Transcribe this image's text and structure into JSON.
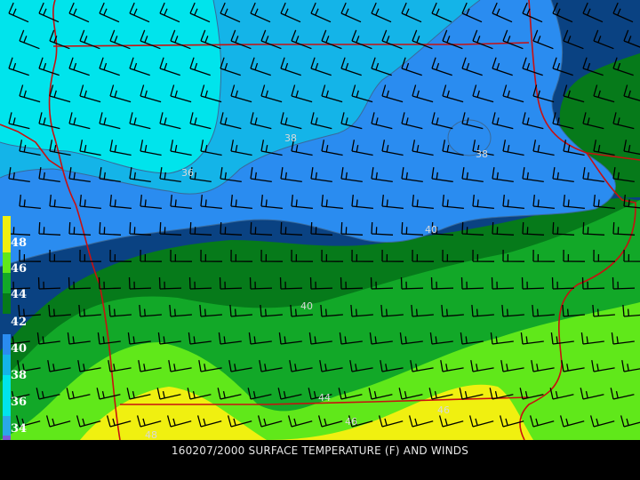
{
  "caption": "160207/2000 SURFACE TEMPERATURE (F) AND WINDS",
  "legend": {
    "labels": [
      "48",
      "46",
      "44",
      "42",
      "40",
      "38",
      "36",
      "34"
    ]
  },
  "contour_labels": [
    "36",
    "38",
    "38",
    "40",
    "40",
    "44",
    "46",
    "46",
    "48"
  ],
  "colors": {
    "band_34_36": "#00e4ec",
    "band_36_38": "#14b4e8",
    "band_38_40": "#2a8cf0",
    "band_40_42": "#0a4282",
    "band_42_44": "#067a1a",
    "band_44_46": "#12a828",
    "band_46_48": "#60e81a",
    "band_48_50": "#f0f010",
    "state_borders": "#c81010",
    "barbs": "#000000"
  }
}
